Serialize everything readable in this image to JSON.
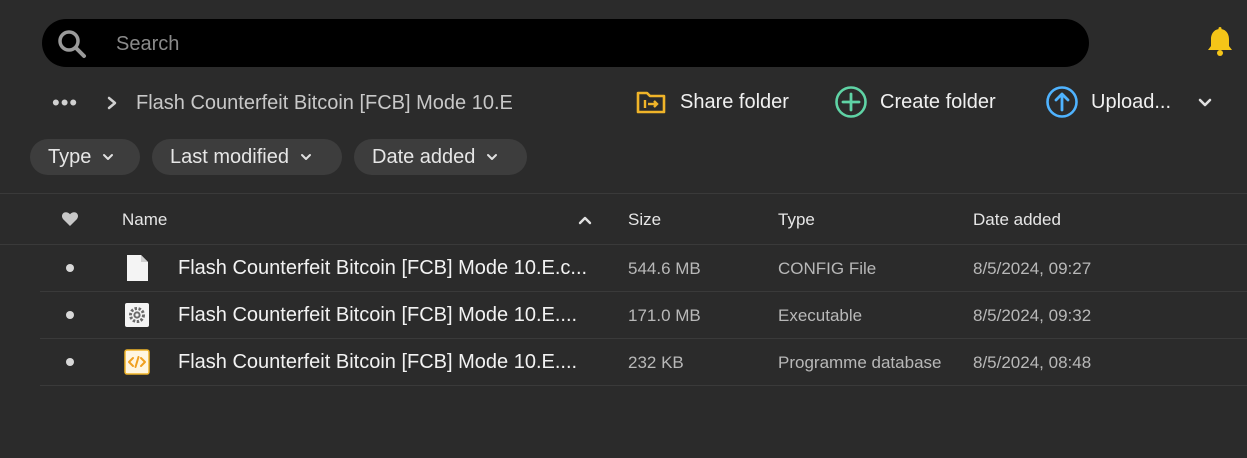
{
  "search": {
    "placeholder": "Search",
    "value": ""
  },
  "icons": {
    "search": "search-icon",
    "notifications": "bell-icon",
    "share": "share-folder-icon",
    "create": "plus-circle-icon",
    "upload": "upload-arrow-icon"
  },
  "colors": {
    "background": "#2b2b2b",
    "search_bg": "#000000",
    "bell": "#f5c518",
    "share_icon": "#f0b429",
    "create_icon": "#5fd3a5",
    "upload_icon": "#4fb3ff",
    "filter_bg": "#3d3d3d"
  },
  "breadcrumb": {
    "overflow": "•••",
    "current": "Flash Counterfeit Bitcoin [FCB] Mode 10.E"
  },
  "actions": {
    "share": "Share folder",
    "create": "Create folder",
    "upload": "Upload..."
  },
  "filters": {
    "type": "Type",
    "modified": "Last modified",
    "added": "Date added"
  },
  "table": {
    "headers": {
      "name": "Name",
      "size": "Size",
      "type": "Type",
      "date": "Date added"
    },
    "sort": {
      "column": "Name",
      "direction": "ascending"
    },
    "rows": [
      {
        "name": "Flash Counterfeit Bitcoin [FCB] Mode 10.E.c...",
        "size": "544.6 MB",
        "type": "CONFIG File",
        "date": "8/5/2024, 09:27",
        "icon": "document-icon"
      },
      {
        "name": "Flash Counterfeit Bitcoin [FCB] Mode 10.E....",
        "size": "171.0 MB",
        "type": "Executable",
        "date": "8/5/2024, 09:32",
        "icon": "gear-icon"
      },
      {
        "name": "Flash Counterfeit Bitcoin [FCB] Mode 10.E....",
        "size": "232 KB",
        "type": "Programme database",
        "date": "8/5/2024, 08:48",
        "icon": "code-file-icon"
      }
    ]
  }
}
